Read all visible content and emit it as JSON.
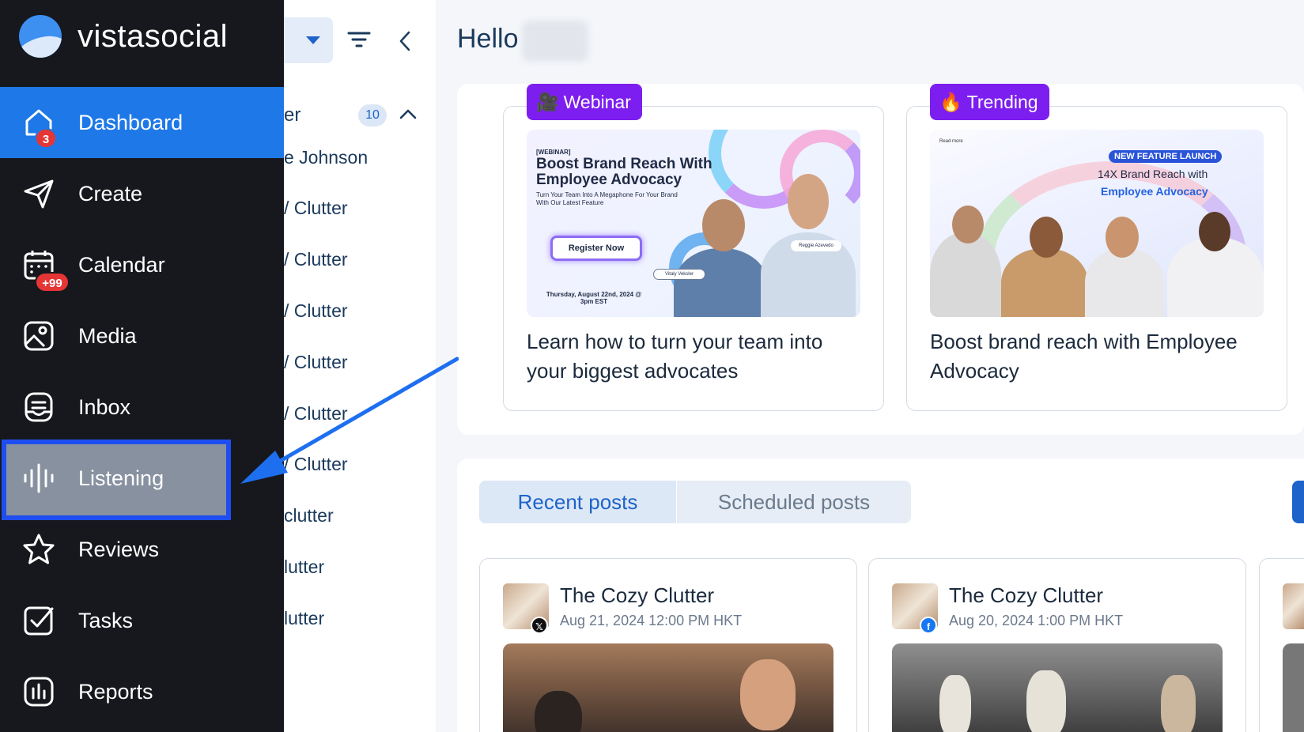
{
  "brand": {
    "name": "vistasocial"
  },
  "nav": {
    "items": [
      {
        "label": "Dashboard",
        "icon": "home-icon",
        "badge": "3",
        "active": true
      },
      {
        "label": "Create",
        "icon": "send-icon"
      },
      {
        "label": "Calendar",
        "icon": "calendar-icon",
        "badge": "+99"
      },
      {
        "label": "Media",
        "icon": "image-icon"
      },
      {
        "label": "Inbox",
        "icon": "inbox-icon"
      },
      {
        "label": "Listening",
        "icon": "soundwave-icon",
        "highlighted": true
      },
      {
        "label": "Reviews",
        "icon": "star-icon"
      },
      {
        "label": "Tasks",
        "icon": "checkbox-icon"
      },
      {
        "label": "Reports",
        "icon": "bar-chart-icon"
      }
    ]
  },
  "subpanel": {
    "group_label": "er",
    "group_count": "10",
    "items": [
      "e Johnson",
      "/ Clutter",
      "/ Clutter",
      "/ Clutter",
      "/ Clutter",
      "/ Clutter",
      "/ Clutter",
      "clutter",
      "lutter",
      "lutter"
    ]
  },
  "greeting": {
    "text": "Hello"
  },
  "promos": [
    {
      "tag": "Webinar",
      "tag_icon": "camera-emoji",
      "title": "Learn how to turn your team into your biggest advocates",
      "image": {
        "kicker": "[WEBINAR]",
        "heading": "Boost Brand Reach With Employee Advocacy",
        "subheading": "Turn Your Team Into A Megaphone For Your Brand With Our Latest Feature",
        "button": "Register Now",
        "date": "Thursday, August 22nd, 2024 @ 3pm EST",
        "speaker1": "Vitaly Veksler",
        "speaker2": "Reggie Azevedo"
      }
    },
    {
      "tag": "Trending",
      "tag_icon": "fire-emoji",
      "title": "Boost brand reach with Employee Advocacy",
      "image": {
        "read_more": "Read more",
        "launch": "NEW FEATURE LAUNCH",
        "line1": "14X Brand Reach with",
        "line2": "Employee Advocacy"
      }
    }
  ],
  "tabs": {
    "recent": "Recent posts",
    "scheduled": "Scheduled posts"
  },
  "posts": [
    {
      "name": "The Cozy Clutter",
      "date": "Aug 21, 2024 12:00 PM HKT",
      "network": "x-icon",
      "network_glyph": "𝕏"
    },
    {
      "name": "The Cozy Clutter",
      "date": "Aug 20, 2024 1:00 PM HKT",
      "network": "facebook-icon",
      "network_glyph": "f"
    }
  ],
  "colors": {
    "nav_bg": "#16181d",
    "active": "#1e78e8",
    "accent": "#1e63c9",
    "tag": "#7d1ef0",
    "highlight": "#1f4ef0"
  }
}
